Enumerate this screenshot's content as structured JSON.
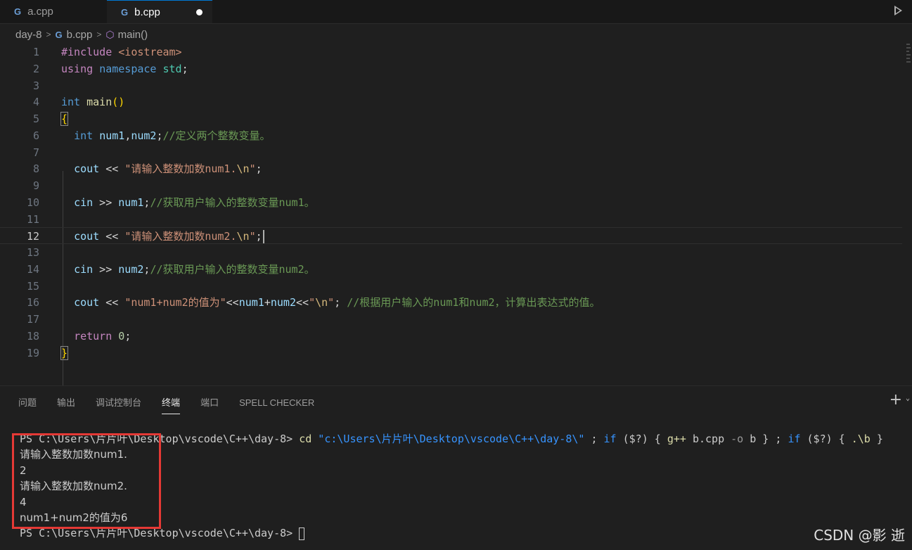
{
  "tabs": [
    {
      "label": "a.cpp",
      "icon": "c++-file-icon",
      "active": false
    },
    {
      "label": "b.cpp",
      "icon": "c++-file-icon",
      "active": true,
      "unsaved": true
    }
  ],
  "breadcrumb": {
    "folder": "day-8",
    "file": "b.cpp",
    "symbol": "main()"
  },
  "editor": {
    "current_line": 12,
    "lines": [
      {
        "n": "1"
      },
      {
        "n": "2"
      },
      {
        "n": "3"
      },
      {
        "n": "4"
      },
      {
        "n": "5"
      },
      {
        "n": "6"
      },
      {
        "n": "7"
      },
      {
        "n": "8"
      },
      {
        "n": "9"
      },
      {
        "n": "10"
      },
      {
        "n": "11"
      },
      {
        "n": "12"
      },
      {
        "n": "13"
      },
      {
        "n": "14"
      },
      {
        "n": "15"
      },
      {
        "n": "16"
      },
      {
        "n": "17"
      },
      {
        "n": "18"
      },
      {
        "n": "19"
      }
    ],
    "code": {
      "l1_pp": "#include",
      "l1_inc": "<iostream>",
      "l2_using": "using",
      "l2_ns": "namespace",
      "l2_std": "std",
      "l2_semi": ";",
      "l4_int": "int",
      "l4_main": "main",
      "l4_paren": "()",
      "l5_brace": "{",
      "l6_int": "int",
      "l6_vars": "num1",
      "l6_comma": ",",
      "l6_vars2": "num2",
      "l6_semi": ";",
      "l6_cmt": "//定义两个整数变量。",
      "l8_cout": "cout",
      "l8_op": " << ",
      "l8_str": "\"请输入整数加数num1.",
      "l8_esc": "\\n",
      "l8_end": "\"",
      "l8_semi": ";",
      "l10_cin": "cin",
      "l10_op": " >> ",
      "l10_var": "num1",
      "l10_semi": ";",
      "l10_cmt": "//获取用户输入的整数变量num1。",
      "l12_cout": "cout",
      "l12_op": " << ",
      "l12_str": "\"请输入整数加数num2.",
      "l12_esc": "\\n",
      "l12_end": "\"",
      "l12_semi": ";",
      "l14_cin": "cin",
      "l14_op": " >> ",
      "l14_var": "num2",
      "l14_semi": ";",
      "l14_cmt": "//获取用户输入的整数变量num2。",
      "l16_cout": "cout",
      "l16_op": " << ",
      "l16_str": "\"num1+num2的值为\"",
      "l16_op2": "<<",
      "l16_v1": "num1",
      "l16_plus": "+",
      "l16_v2": "num2",
      "l16_op3": "<<",
      "l16_str2a": "\"",
      "l16_esc": "\\n",
      "l16_str2b": "\"",
      "l16_semi": "; ",
      "l16_cmt": "//根据用户输入的num1和num2，计算出表达式的值。",
      "l18_ret": "return",
      "l18_num": "0",
      "l18_semi": ";",
      "l19_brace": "}"
    }
  },
  "panel": {
    "tabs": [
      "问题",
      "输出",
      "调试控制台",
      "终端",
      "端口",
      "SPELL CHECKER"
    ],
    "active_tab": "终端",
    "add_icon": "+"
  },
  "terminal": {
    "prompt": "PS C:\\Users\\片片叶\\Desktop\\vscode\\C++\\day-8> ",
    "cmd_cd": "cd",
    "cmd_path": "\"c:\\Users\\片片叶\\Desktop\\vscode\\C++\\day-8\\\"",
    "cmd_sep1": " ; ",
    "cmd_if1": "if",
    "cmd_cond1": " ($?) { ",
    "cmd_gpp": "g++",
    "cmd_file": " b.cpp ",
    "cmd_flag": "-o",
    "cmd_out": " b } ; ",
    "cmd_if2": "if",
    "cmd_cond2": " ($?) { ",
    "cmd_run": ".\\b",
    "cmd_close": " }",
    "output": [
      "请输入整数加数num1.",
      "2",
      "请输入整数加数num2.",
      "4",
      "num1+num2的值为6"
    ],
    "prompt2": "PS C:\\Users\\片片叶\\Desktop\\vscode\\C++\\day-8> "
  },
  "watermark": "CSDN @影 逝",
  "colors": {
    "annotation_box": "#e53935",
    "accent": "#0078d4"
  }
}
